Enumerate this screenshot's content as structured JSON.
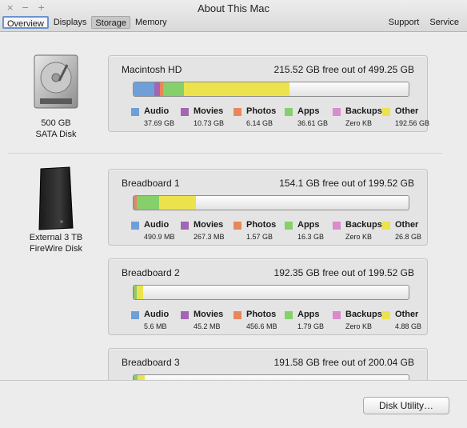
{
  "window": {
    "title": "About This Mac",
    "close": "×",
    "minimize": "−",
    "zoom": "+"
  },
  "tabs": [
    "Overview",
    "Displays",
    "Storage",
    "Memory"
  ],
  "links": [
    "Support",
    "Service"
  ],
  "colors": {
    "audio": "#6f9fd8",
    "movies": "#a366b3",
    "photos": "#e9875a",
    "apps": "#85d06a",
    "backups": "#d98bcc",
    "other": "#ece34c"
  },
  "legend_labels": [
    "Audio",
    "Movies",
    "Photos",
    "Apps",
    "Backups",
    "Other"
  ],
  "devices": [
    {
      "name": "500 GB",
      "type": "SATA Disk",
      "icon": "hard-drive-icon"
    },
    {
      "name": "External 3 TB",
      "type": "FireWire Disk",
      "icon": "external-drive-icon"
    }
  ],
  "volumes": [
    {
      "name": "Macintosh HD",
      "free": "215.52 GB free out of 499.25 GB",
      "sizes": [
        "37.69 GB",
        "10.73 GB",
        "6.14 GB",
        "36.61 GB",
        "Zero KB",
        "192.56 GB"
      ],
      "fractions": {
        "audio": 0.075,
        "movies": 0.0215,
        "photos": 0.0123,
        "apps": 0.0733,
        "backups": 0.0,
        "other": 0.3857
      }
    },
    {
      "name": "Breadboard 1",
      "free": "154.1 GB free out of 199.52 GB",
      "sizes": [
        "490.9 MB",
        "267.3 MB",
        "1.57 GB",
        "16.3 GB",
        "Zero KB",
        "26.8 GB"
      ],
      "fractions": {
        "audio": 0.0025,
        "movies": 0.0013,
        "photos": 0.0079,
        "apps": 0.0817,
        "backups": 0.0,
        "other": 0.1343
      }
    },
    {
      "name": "Breadboard 2",
      "free": "192.35 GB free out of 199.52 GB",
      "sizes": [
        "5.6 MB",
        "45.2 MB",
        "456.6 MB",
        "1.79 GB",
        "Zero KB",
        "4.88 GB"
      ],
      "fractions": {
        "audio": 0.0001,
        "movies": 0.0002,
        "photos": 0.0023,
        "apps": 0.009,
        "backups": 0.0,
        "other": 0.0245
      }
    },
    {
      "name": "Breadboard 3",
      "free": "191.58 GB free out of 200.04 GB",
      "sizes": [
        "",
        "",
        "",
        "",
        "",
        ""
      ],
      "fractions": {
        "audio": 0.0002,
        "movies": 0.0002,
        "photos": 0.003,
        "apps": 0.01,
        "backups": 0.0,
        "other": 0.028
      }
    }
  ],
  "footer": {
    "disk_utility": "Disk Utility…"
  }
}
